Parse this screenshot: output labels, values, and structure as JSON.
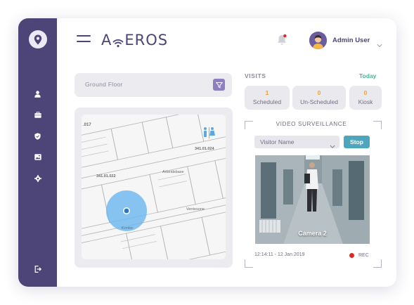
{
  "brand": {
    "name_left": "A",
    "name_right": "EROS"
  },
  "colors": {
    "sidebar": "#4d4577",
    "accent": "#8d7fc0",
    "today": "#3db99a",
    "count": "#f0a13a",
    "stop": "#4ea6bc",
    "rec": "#e02828"
  },
  "sidebar": {
    "items": [
      {
        "icon": "user-icon"
      },
      {
        "icon": "briefcase-icon"
      },
      {
        "icon": "shield-icon"
      },
      {
        "icon": "image-icon"
      },
      {
        "icon": "gear-icon"
      }
    ],
    "bottom_icon": "logout-icon"
  },
  "header": {
    "user_name": "Admin User",
    "notification": true
  },
  "floor": {
    "selected": "Ground Floor"
  },
  "map": {
    "labels": {
      "top_left": ".017",
      "room_a": "341.01.022",
      "room_b": "Arbeidsbase",
      "room_c": "341.01.024",
      "room_d": "Ventesone",
      "room_e": "Kontor"
    }
  },
  "visits": {
    "title": "VISITS",
    "period": "Today",
    "stats": [
      {
        "count": "1",
        "label": "Scheduled"
      },
      {
        "count": "0",
        "label": "Un-Scheduled"
      },
      {
        "count": "0",
        "label": "Kiosk"
      }
    ]
  },
  "surveillance": {
    "title": "VIDEO SURVEILLANCE",
    "visitor_select": "Visitor Name",
    "stop_label": "Stop",
    "camera_name": "Camera 2",
    "timestamp": "12:14:11 - 12 Jan 2019",
    "rec_label": "REC"
  }
}
